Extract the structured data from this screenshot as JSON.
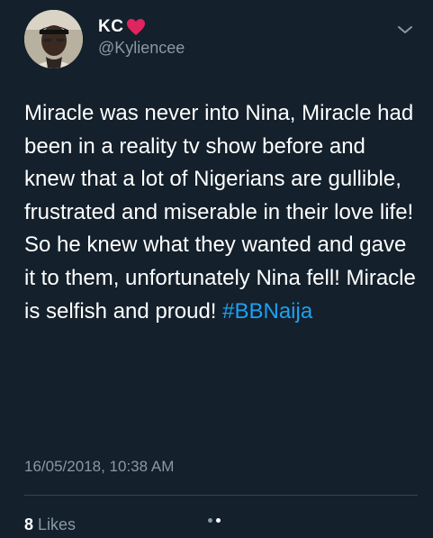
{
  "user": {
    "display_name": "KC",
    "handle": "@Kyliencee"
  },
  "tweet": {
    "text": "Miracle was never into Nina, Miracle had been in a reality tv show before and knew that a lot of Nigerians are gullible, frustrated and miserable in their love life! So he knew what they wanted and gave it to them, unfortunately Nina fell! Miracle is selfish and proud!",
    "hashtag": "#BBNaija",
    "timestamp": "16/05/2018, 10:38 AM"
  },
  "stats": {
    "likes_count": "8",
    "likes_label": "Likes"
  },
  "colors": {
    "background": "#14202b",
    "text_primary": "#ffffff",
    "text_secondary": "#8899a6",
    "hashtag": "#1da1f2",
    "heart": "#e0245e"
  },
  "icons": {
    "heart": "heart-emoji-icon",
    "menu": "chevron-down-icon"
  },
  "pager": {
    "count": 2,
    "active_index": 1
  }
}
